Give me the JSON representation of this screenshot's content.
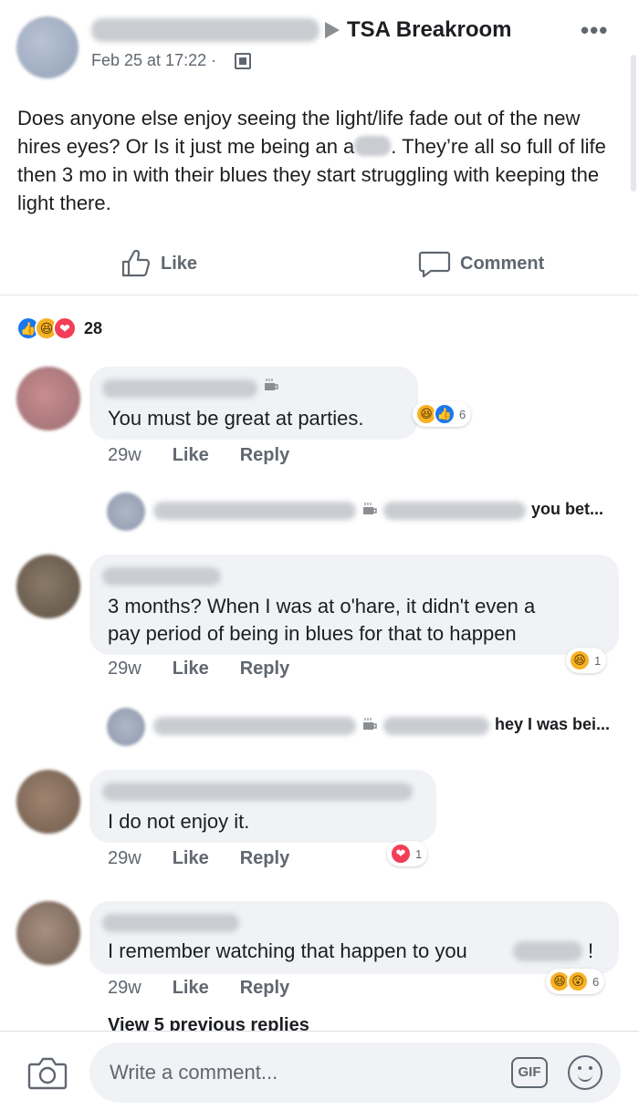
{
  "post": {
    "group_name": "TSA Breakroom",
    "date": "Feb 25 at 17:22 ·",
    "text_part1": "Does anyone else enjoy seeing the light/life fade out of the new hires eyes? Or Is it just me being an a",
    "text_part2": ". They’re all so full of life then 3 mo in with their blues they start struggling with keeping the light there.",
    "more_icon": "•••",
    "like_label": "Like",
    "comment_label": "Comment",
    "reaction_count": "28",
    "reactions": [
      "like",
      "haha",
      "love"
    ]
  },
  "comments": [
    {
      "text": "You must be great at parties.",
      "time": "29w",
      "like": "Like",
      "reply": "Reply",
      "reaction_count": "6",
      "reactions": [
        "haha",
        "like"
      ]
    },
    {
      "text_line1": "3 months? When I was at o'hare, it didn't even a",
      "text_line2": "pay period of being in blues for that to happen",
      "time": "29w",
      "like": "Like",
      "reply": "Reply",
      "reaction_count": "1",
      "reactions": [
        "haha"
      ]
    },
    {
      "text": "I do not enjoy it.",
      "time": "29w",
      "like": "Like",
      "reply": "Reply",
      "reaction_count": "1",
      "reactions": [
        "love"
      ]
    },
    {
      "text": "I remember watching that happen to you",
      "text_end": "!",
      "time": "29w",
      "like": "Like",
      "reply": "Reply",
      "reaction_count": "6",
      "reactions": [
        "haha",
        "wow"
      ]
    }
  ],
  "replies": [
    {
      "snippet": "you bet..."
    },
    {
      "snippet": "hey I was bei..."
    }
  ],
  "view_previous": "View 5 previous replies",
  "composer": {
    "placeholder": "Write a comment...",
    "gif_label": "GIF"
  },
  "colors": {
    "accent": "#1877f2",
    "bubble": "#f0f2f5",
    "muted_text": "#606770",
    "haha": "#f7b125",
    "love": "#f33e58"
  }
}
